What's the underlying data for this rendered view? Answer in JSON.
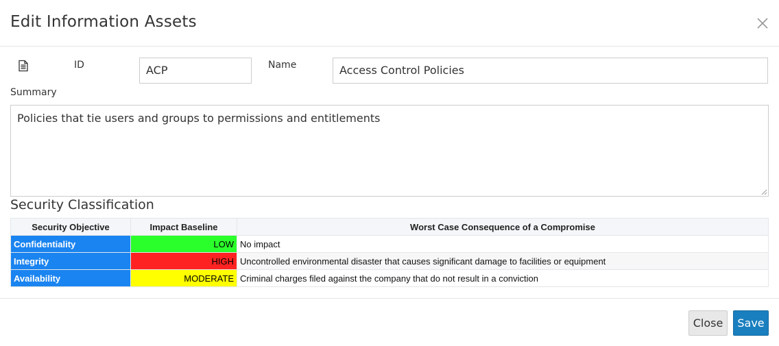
{
  "dialog": {
    "title": "Edit Information Assets",
    "close_icon": "close-icon"
  },
  "form": {
    "doc_icon": "document-icon",
    "id_label": "ID",
    "id_value": "ACP",
    "name_label": "Name",
    "name_value": "Access Control Policies",
    "summary_label": "Summary",
    "summary_value": "Policies that tie users and groups to permissions and entitlements"
  },
  "security": {
    "title": "Security Classification",
    "columns": [
      "Security Objective",
      "Impact Baseline",
      "Worst Case Consequence of a Compromise"
    ],
    "rows": [
      {
        "objective": "Confidentiality",
        "impact": "LOW",
        "impact_color": "#2bff2b",
        "consequence": "No impact"
      },
      {
        "objective": "Integrity",
        "impact": "HIGH",
        "impact_color": "#ff2222",
        "consequence": "Uncontrolled environmental disaster that causes significant damage to facilities or equipment"
      },
      {
        "objective": "Availability",
        "impact": "MODERATE",
        "impact_color": "#ffff00",
        "consequence": "Criminal charges filed against the company that do not result in a conviction"
      }
    ],
    "objective_color": "#1a84f0"
  },
  "footer": {
    "close_label": "Close",
    "save_label": "Save"
  }
}
